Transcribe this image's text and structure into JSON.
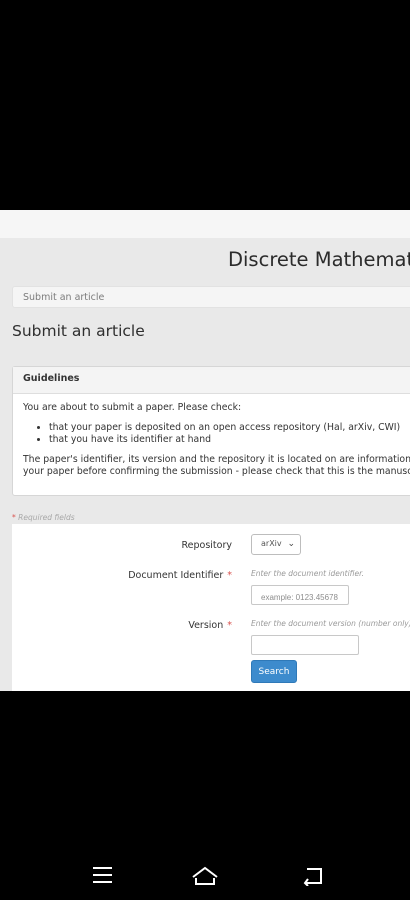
{
  "header": {
    "journal_title": "Discrete Mathematics"
  },
  "breadcrumb": {
    "label": "Submit an article"
  },
  "page": {
    "title": "Submit an article"
  },
  "guidelines": {
    "heading": "Guidelines",
    "intro": "You are about to submit a paper. Please check:",
    "items": [
      "that your paper is deposited on an open access repository (Hal, arXiv, CWI)",
      "that you have its identifier at hand"
    ],
    "note_line1": "The paper's identifier, its version and the repository it is located on are information that ne",
    "note_line2": "your paper before confirming the submission - please check that this is the manuscript you"
  },
  "form": {
    "required_note": "Required fields",
    "repository": {
      "label": "Repository",
      "value": "arXiv"
    },
    "document_identifier": {
      "label": "Document Identifier",
      "help": "Enter the document identifier.",
      "placeholder": "example: 0123.45678"
    },
    "version": {
      "label": "Version",
      "help": "Enter the document version (number only).",
      "value": ""
    },
    "search_button": "Search"
  },
  "android_nav": {
    "icons": [
      "menu-icon",
      "home-icon",
      "back-icon"
    ]
  },
  "colors": {
    "primary_button": "#3d8bcd",
    "required_star": "#d9534f"
  }
}
